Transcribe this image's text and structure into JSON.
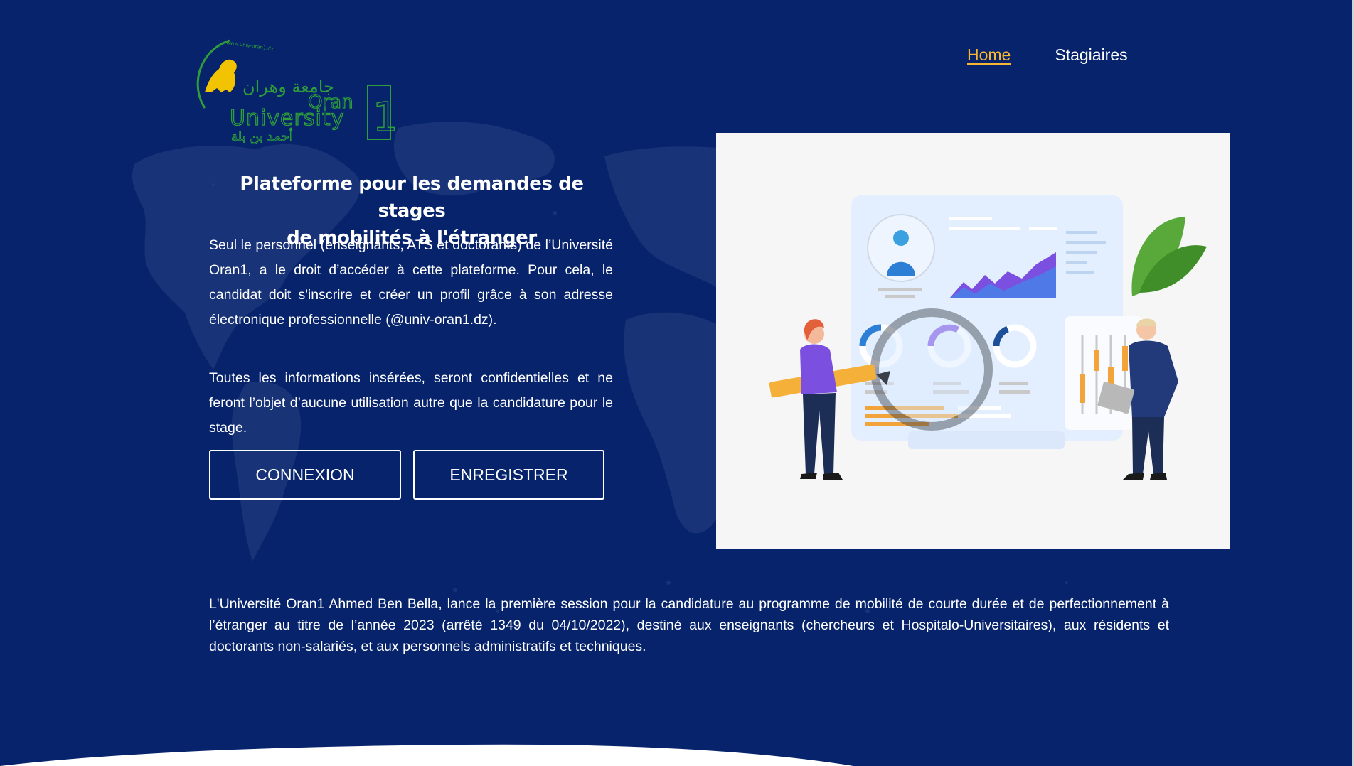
{
  "nav": {
    "items": [
      {
        "label": "Home",
        "active": true
      },
      {
        "label": "Stagiaires",
        "active": false
      }
    ],
    "active_color": "#f7b733"
  },
  "logo": {
    "arabic_top": "جامعة وهران",
    "latin_line1": "Oran",
    "latin_line2": "University",
    "arabic_bottom": "أحمد بن بلة",
    "number": "1",
    "url": "www.univ-oran1.dz",
    "colors": {
      "green": "#2e9e3a",
      "lion": "#f2c300"
    }
  },
  "hero": {
    "title_line1": "Plateforme pour les demandes de stages",
    "title_line2": "de mobilités à l'étranger",
    "paragraph1": "Seul le personnel (enseignants, ATS et doctorants) de l’Université Oran1, a le droit d’accéder à cette plateforme. Pour cela, le candidat doit s'inscrire et créer un profil grâce à son adresse électronique professionnelle (@univ-oran1.dz).",
    "paragraph2": "Toutes les informations insérées, seront confidentielles et ne feront l’objet d’aucune utilisation autre que la candidature pour le stage.",
    "login_button": "CONNEXION",
    "register_button": "ENREGISTRER"
  },
  "announcement": "L'Université Oran1 Ahmed Ben Bella, lance la première session pour la candidature au programme de mobilité de courte durée et de perfectionnement à l’étranger au titre de l’année 2023 (arrêté 1349 du 04/10/2022), destiné aux enseignants (chercheurs et Hospitalo-Universitaires), aux résidents et doctorants non-salariés, et aux personnels administratifs et techniques.",
  "theme": {
    "background": "#06236b",
    "map_tint": "#1f3a78",
    "illustration_bg": "#f6f6f6"
  }
}
